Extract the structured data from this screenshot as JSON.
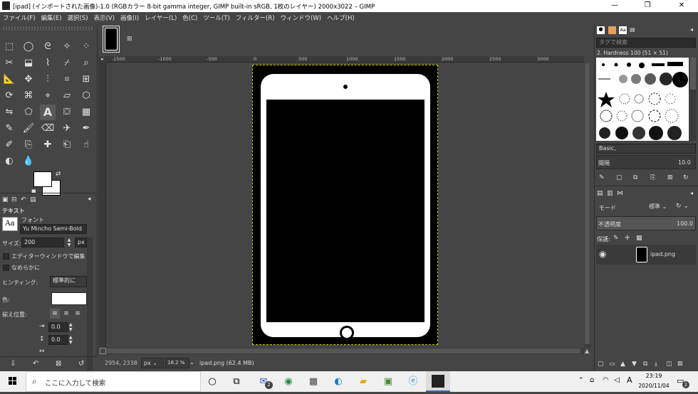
{
  "window": {
    "title": "[ipad] (インポートされた画像)-1.0 (RGBカラー 8-bit gamma integer, GIMP built-in sRGB, 1枚のレイヤー) 2000x3022 – GIMP",
    "minimize": "—",
    "maximize": "❐",
    "close": "✕"
  },
  "menu": [
    "ファイル(F)",
    "編集(E)",
    "選択(S)",
    "表示(V)",
    "画像(I)",
    "レイヤー(L)",
    "色(C)",
    "ツール(T)",
    "フィルター(R)",
    "ウィンドウ(W)",
    "ヘルプ(H)"
  ],
  "toolbox": {
    "tools": [
      "rect-select",
      "ellipse-select",
      "free-select",
      "fuzzy-select",
      "by-color-select",
      "scissors",
      "foreground-select",
      "paths",
      "color-picker",
      "zoom",
      "measure",
      "move",
      "align",
      "crop",
      "unified-transform",
      "rotate",
      "warp",
      "handle-transform",
      "perspective",
      "3d-transform",
      "flip",
      "cage",
      "text",
      "bucket-fill",
      "gradient",
      "pencil",
      "paintbrush",
      "eraser",
      "airbrush",
      "ink",
      "mypaint",
      "clone",
      "heal",
      "perspective-clone",
      "smudge",
      "dodge-burn",
      "blur-sharpen"
    ],
    "options_title": "テキスト",
    "font_label": "フォント",
    "font_value": "Yu Mincho Semi-Bold",
    "size_label": "サイズ:",
    "size_value": "200",
    "size_unit": "px",
    "editor_label": "エディターウィンドウで編集",
    "antialias_label": "なめらかに",
    "hinting_label": "ヒンティング:",
    "hinting_value": "標準的に",
    "color_label": "色:",
    "justify_label": "揃え位置:",
    "indent_value": "0.0",
    "linespace_value": "0.0"
  },
  "ruler": {
    "labels": [
      "-1500",
      "-1000",
      "-500",
      "0",
      "500",
      "1000",
      "1500",
      "2000",
      "2500",
      "3000"
    ]
  },
  "status": {
    "coords": "2954, 2338",
    "unit": "px",
    "zoom": "18.2 %",
    "info": "ipad.png (62.4 MB)"
  },
  "brushes": {
    "filter_placeholder": "タグで検索",
    "current": "2. Hardness 100 (51 × 51)",
    "preset": "Basic,",
    "spacing_label": "間隔",
    "spacing_value": "10.0"
  },
  "layers": {
    "mode_label": "モード",
    "mode_value": "標準",
    "opacity_label": "不透明度",
    "opacity_value": "100.0",
    "lock_label": "保護:",
    "items": [
      {
        "name": "ipad.png"
      }
    ]
  },
  "taskbar": {
    "search_placeholder": "ここに入力して検索",
    "mail_badge": "2",
    "ime": "A",
    "time": "23:19",
    "date": "2020/11/04",
    "notif_badge": "2"
  }
}
